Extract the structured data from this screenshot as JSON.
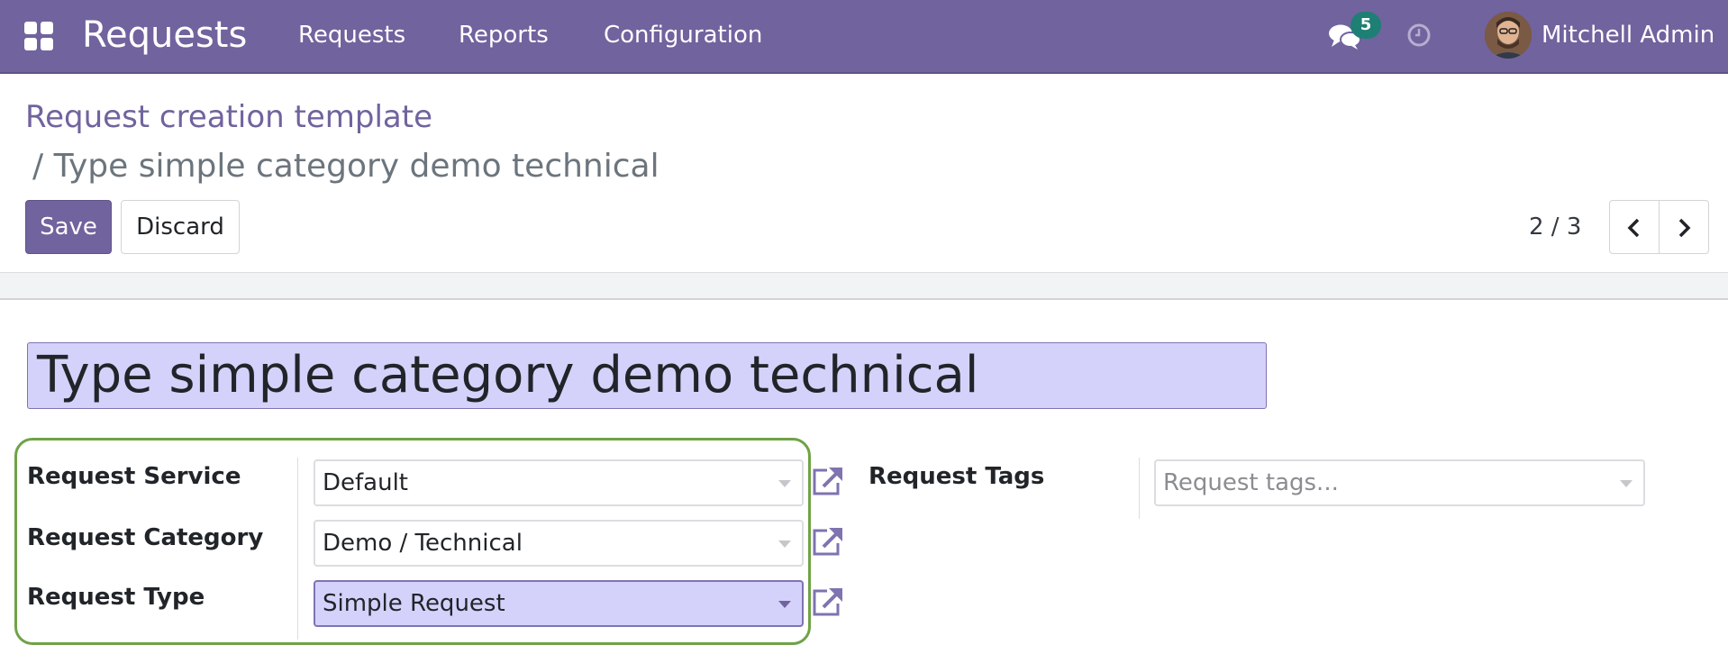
{
  "topbar": {
    "app_title": "Requests",
    "menu": [
      "Requests",
      "Reports",
      "Configuration"
    ],
    "messages_count": "5",
    "user_name": "Mitchell Admin"
  },
  "breadcrumb": {
    "parent": "Request creation template",
    "current": "/ Type simple category demo technical"
  },
  "actions": {
    "save_label": "Save",
    "discard_label": "Discard"
  },
  "pager": {
    "value": "2 / 3"
  },
  "record": {
    "title": "Type simple category demo technical"
  },
  "fields": {
    "service": {
      "label": "Request Service",
      "value": "Default"
    },
    "category": {
      "label": "Request Category",
      "value": "Demo / Technical"
    },
    "type": {
      "label": "Request Type",
      "value": "Simple Request"
    },
    "tags": {
      "label": "Request Tags",
      "placeholder": "Request tags..."
    }
  },
  "colors": {
    "brand": "#71639e",
    "badge": "#1e7f75",
    "active_field": "#d4d2fb",
    "highlight": "#6fa346"
  }
}
